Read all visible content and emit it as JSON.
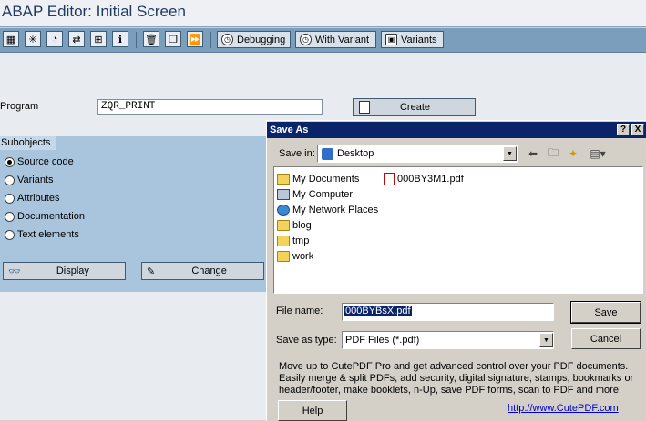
{
  "editor": {
    "title": "ABAP Editor: Initial Screen",
    "toolbar": {
      "icons": [
        "display-object-list-icon",
        "other-object-icon",
        "check-icon",
        "activate-icon",
        "where-used-icon",
        "info-icon",
        "delete-icon",
        "copy-icon",
        "execute-icon"
      ],
      "debugging_label": "Debugging",
      "with_variant_label": "With Variant",
      "variants_label": "Variants"
    },
    "program_label": "Program",
    "program_value": "ZQR_PRINT",
    "create_label": "Create",
    "subobjects": {
      "tab_label": "Subobjects",
      "options": [
        {
          "label": "Source code",
          "checked": true
        },
        {
          "label": "Variants",
          "checked": false
        },
        {
          "label": "Attributes",
          "checked": false
        },
        {
          "label": "Documentation",
          "checked": false
        },
        {
          "label": "Text elements",
          "checked": false
        }
      ],
      "display_label": "Display",
      "change_label": "Change"
    }
  },
  "dialog": {
    "title": "Save As",
    "help_caption": "?",
    "close_caption": "X",
    "save_in_label": "Save in:",
    "save_in_value": "Desktop",
    "files": [
      {
        "name": "My Documents",
        "icon": "docs"
      },
      {
        "name": "My Computer",
        "icon": "pc"
      },
      {
        "name": "My Network Places",
        "icon": "net"
      },
      {
        "name": "blog",
        "icon": "folder"
      },
      {
        "name": "tmp",
        "icon": "folder"
      },
      {
        "name": "work",
        "icon": "folder"
      },
      {
        "name": "000BY3M1.pdf",
        "icon": "pdf"
      }
    ],
    "file_name_label": "File name:",
    "file_name_value": "000BYBsX.pdf",
    "save_as_type_label": "Save as type:",
    "save_as_type_value": "PDF Files (*.pdf)",
    "save_label": "Save",
    "cancel_label": "Cancel",
    "help_label": "Help",
    "promo_text": "Move up to CutePDF Pro and get advanced control over your PDF documents. Easily merge & split PDFs, add security, digital signature, stamps, bookmarks or header/footer, make booklets, n-Up, save PDF forms, scan to PDF and more!",
    "link_text": "http://www.CutePDF.com"
  },
  "colors": {
    "sap_toolbar": "#7b9ebc",
    "subobjects_bg": "#a9c4dd",
    "dialog_titlebar": "#0a246a",
    "selection": "#0a246a"
  }
}
